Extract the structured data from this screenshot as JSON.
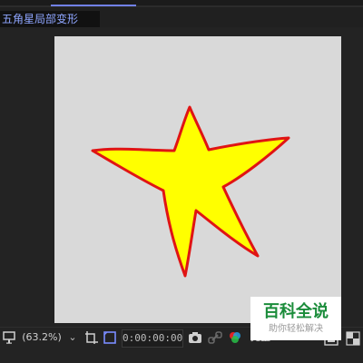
{
  "comp_tab": {
    "title": "五角星局部变形"
  },
  "bottom_bar": {
    "zoom": "(63.2%)",
    "timecode": "0:00:00:00",
    "resolution": "完整"
  },
  "watermark": {
    "title": "百科全说",
    "subtitle": "助你轻松解决"
  },
  "colors": {
    "star_fill": "#ffff00",
    "star_stroke": "#e01414",
    "canvas_bg": "#d9d9d9",
    "accent": "#7a8cff",
    "watermark_green": "#1a8c3a"
  },
  "icons": {
    "monitor": "monitor-icon",
    "zoom_dropdown": "chevron-down-icon",
    "region_of_interest": "region-icon",
    "transparency_grid": "transparency-grid-icon",
    "snapshot": "camera-icon",
    "show_snapshot": "link-icon",
    "channels": "color-channels-icon",
    "fast_preview": "fast-preview-icon",
    "grid_toggle": "checkerboard-icon"
  }
}
